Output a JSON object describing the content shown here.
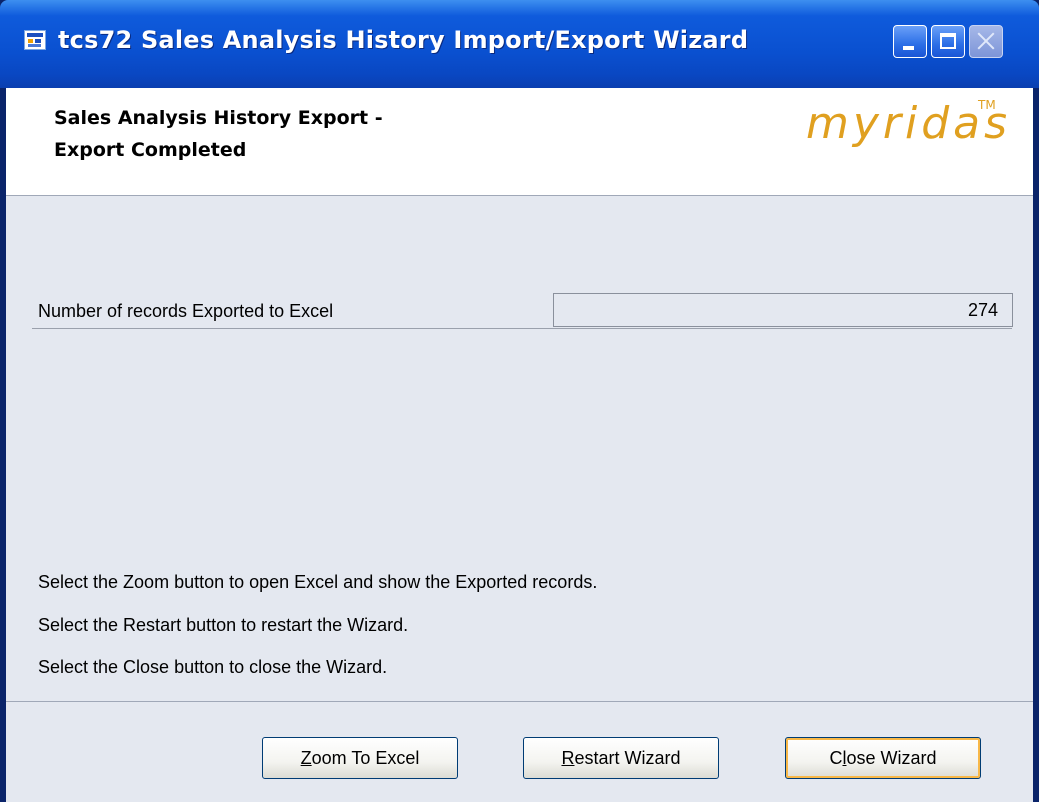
{
  "window": {
    "title": "tcs72 Sales Analysis History Import/Export Wizard"
  },
  "header": {
    "title_line1": "Sales Analysis History Export -",
    "title_line2": "Export Completed",
    "logo_text": "myridas",
    "logo_trademark": "TM"
  },
  "records": {
    "label": "Number of  records Exported to Excel",
    "value": "274"
  },
  "instructions": [
    "Select the Zoom button to open Excel and show the Exported records.",
    "Select the Restart button to restart the Wizard.",
    "Select the Close button to close the Wizard."
  ],
  "buttons": {
    "zoom": {
      "mnemonic": "Z",
      "rest": "oom To Excel"
    },
    "restart": {
      "mnemonic": "R",
      "rest": "estart Wizard"
    },
    "close": {
      "pre": "C",
      "mnemonic": "l",
      "rest": "ose Wizard"
    }
  },
  "colors": {
    "titlebar": "#0a50d0",
    "client_bg": "#e4e8f0",
    "logo": "#e0a020"
  }
}
